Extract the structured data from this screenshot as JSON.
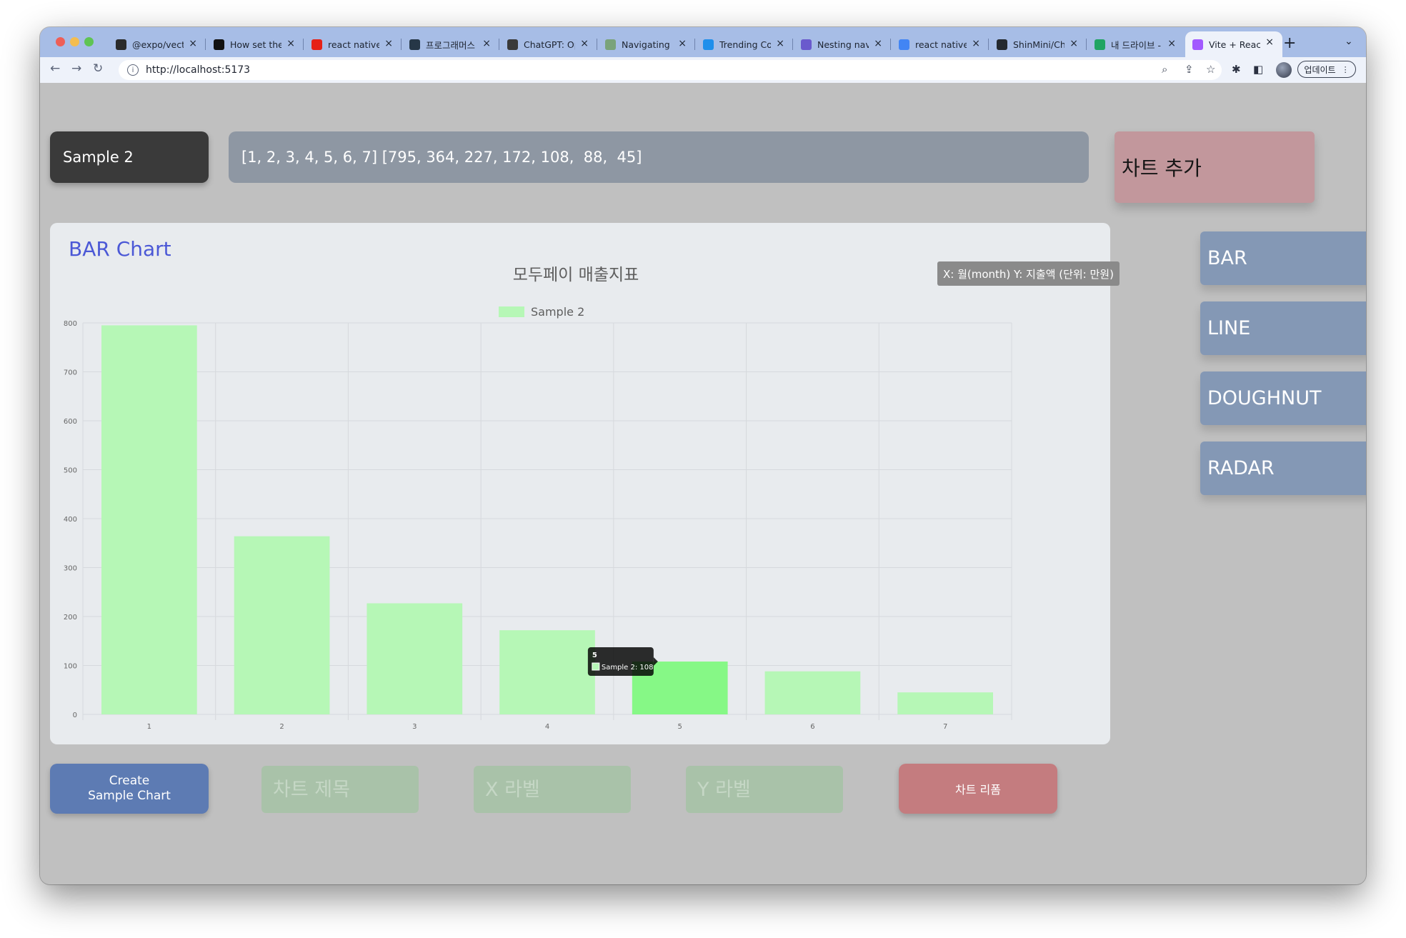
{
  "browser": {
    "tabs": [
      {
        "title": "@expo/vector-icons",
        "icon": "expo-icon",
        "color": "#2b2b2b",
        "active": false
      },
      {
        "title": "How set the",
        "icon": "terminal-icon",
        "color": "#111111",
        "active": false
      },
      {
        "title": "react native",
        "icon": "youtube-icon",
        "color": "#e62117",
        "active": false
      },
      {
        "title": "프로그래머스",
        "icon": "programmers-icon",
        "color": "#263747",
        "active": false
      },
      {
        "title": "ChatGPT: Op",
        "icon": "chatgpt-icon",
        "color": "#3a3a3a",
        "active": false
      },
      {
        "title": "Navigating N",
        "icon": "navigation-icon",
        "color": "#7aa37a",
        "active": false
      },
      {
        "title": "Trending Co",
        "icon": "trending-icon",
        "color": "#1f8feb",
        "active": false
      },
      {
        "title": "Nesting navi",
        "icon": "react-navigation-icon",
        "color": "#6a5acd",
        "active": false
      },
      {
        "title": "react native",
        "icon": "google-icon",
        "color": "#4285f4",
        "active": false
      },
      {
        "title": "ShinMini/Ch",
        "icon": "github-icon",
        "color": "#24292f",
        "active": false
      },
      {
        "title": "내 드라이브 - G",
        "icon": "google-drive-icon",
        "color": "#1fa463",
        "active": false
      },
      {
        "title": "Vite + React",
        "icon": "vite-icon",
        "color": "#a259ff",
        "active": true
      }
    ],
    "url": "http://localhost:5173",
    "update_label": "업데이트"
  },
  "app": {
    "sample_label": "Sample 2",
    "data_value": "[1, 2, 3, 4, 5, 6, 7] [795, 364, 227, 172, 108,  88,  45]",
    "add_chart_label": "차트 추가",
    "card_title": "BAR Chart",
    "axis_label_tip": "X: 월(month) Y: 지출액 (단위: 만원)",
    "chart_types": [
      "BAR",
      "LINE",
      "DOUGHNUT",
      "RADAR"
    ],
    "create_label": "Create\nSample Chart",
    "title_placeholder": "차트 제목",
    "x_placeholder": "X 라벨",
    "y_placeholder": "Y 라벨",
    "reform_label": "차트 리폼",
    "colors": {
      "bar": "#b6f7b6",
      "bar_hover": "#86f886",
      "accent": "#4b58d6",
      "reform": "#c47c7f"
    }
  },
  "chart_data": {
    "type": "bar",
    "title": "모두페이 매출지표",
    "categories": [
      "1",
      "2",
      "3",
      "4",
      "5",
      "6",
      "7"
    ],
    "series": [
      {
        "name": "Sample 2",
        "values": [
          795,
          364,
          227,
          172,
          108,
          88,
          45
        ]
      }
    ],
    "ylim": [
      0,
      800
    ],
    "yticks": [
      "0",
      "100",
      "200",
      "300",
      "400",
      "500",
      "600",
      "700",
      "800"
    ],
    "grid": true,
    "legend": "top",
    "tooltip": {
      "category": "5",
      "text": "Sample 2: 108"
    }
  }
}
